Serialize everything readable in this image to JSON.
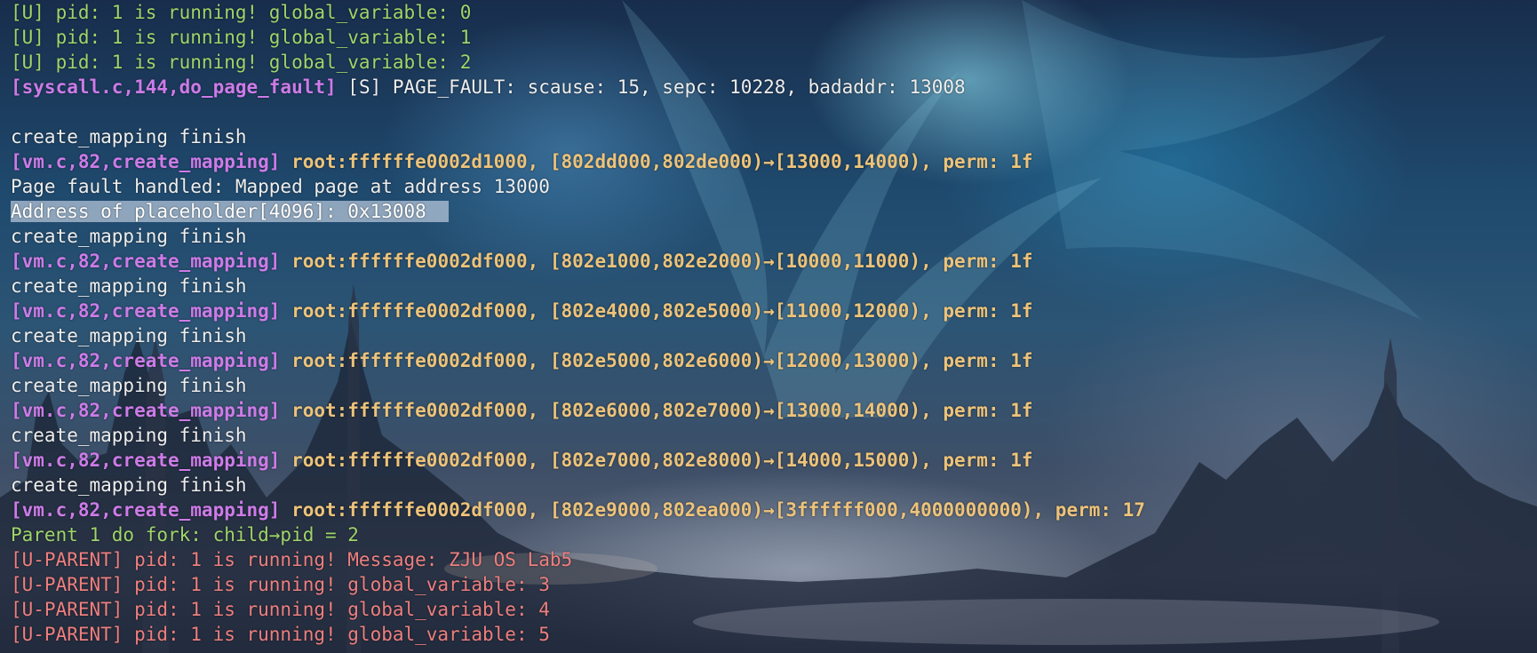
{
  "terminal": {
    "lines": [
      {
        "color": "#9fd56a",
        "segments": [
          {
            "text": "[U] pid: 1 is running! global_variable: 0",
            "style": "green"
          }
        ]
      },
      {
        "color": "#9fd56a",
        "segments": [
          {
            "text": "[U] pid: 1 is running! global_variable: 1",
            "style": "green"
          }
        ]
      },
      {
        "color": "#9fd56a",
        "segments": [
          {
            "text": "[U] pid: 1 is running! global_variable: 2",
            "style": "green"
          }
        ]
      },
      {
        "segments": [
          {
            "text": "[syscall.c,144,do_page_fault]",
            "style": "magenta"
          },
          {
            "text": " [S] PAGE_FAULT: scause: 15, sepc: 10228, badaddr: 13008",
            "style": "white"
          }
        ]
      },
      {
        "segments": [
          {
            "text": "",
            "style": "white"
          }
        ]
      },
      {
        "segments": [
          {
            "text": "create_mapping finish",
            "style": "white"
          }
        ]
      },
      {
        "segments": [
          {
            "text": "[vm.c,82,create_mapping]",
            "style": "magenta"
          },
          {
            "text": " root:ffffffe0002d1000, [802dd000,802de000)→[13000,14000), perm: 1f",
            "style": "orange"
          }
        ]
      },
      {
        "segments": [
          {
            "text": "Page fault handled: Mapped page at address 13000",
            "style": "white"
          }
        ]
      },
      {
        "segments": [
          {
            "text": "Address of placeholder[4096]: 0x13008  ",
            "style": "sel"
          }
        ]
      },
      {
        "segments": [
          {
            "text": "create_mapping finish",
            "style": "white"
          }
        ]
      },
      {
        "segments": [
          {
            "text": "[vm.c,82,create_mapping]",
            "style": "magenta"
          },
          {
            "text": " root:ffffffe0002df000, [802e1000,802e2000)→[10000,11000), perm: 1f",
            "style": "orange"
          }
        ]
      },
      {
        "segments": [
          {
            "text": "create_mapping finish",
            "style": "white"
          }
        ]
      },
      {
        "segments": [
          {
            "text": "[vm.c,82,create_mapping]",
            "style": "magenta"
          },
          {
            "text": " root:ffffffe0002df000, [802e4000,802e5000)→[11000,12000), perm: 1f",
            "style": "orange"
          }
        ]
      },
      {
        "segments": [
          {
            "text": "create_mapping finish",
            "style": "white"
          }
        ]
      },
      {
        "segments": [
          {
            "text": "[vm.c,82,create_mapping]",
            "style": "magenta"
          },
          {
            "text": " root:ffffffe0002df000, [802e5000,802e6000)→[12000,13000), perm: 1f",
            "style": "orange"
          }
        ]
      },
      {
        "segments": [
          {
            "text": "create_mapping finish",
            "style": "white"
          }
        ]
      },
      {
        "segments": [
          {
            "text": "[vm.c,82,create_mapping]",
            "style": "magenta"
          },
          {
            "text": " root:ffffffe0002df000, [802e6000,802e7000)→[13000,14000), perm: 1f",
            "style": "orange"
          }
        ]
      },
      {
        "segments": [
          {
            "text": "create_mapping finish",
            "style": "white"
          }
        ]
      },
      {
        "segments": [
          {
            "text": "[vm.c,82,create_mapping]",
            "style": "magenta"
          },
          {
            "text": " root:ffffffe0002df000, [802e7000,802e8000)→[14000,15000), perm: 1f",
            "style": "orange"
          }
        ]
      },
      {
        "segments": [
          {
            "text": "create_mapping finish",
            "style": "white"
          }
        ]
      },
      {
        "segments": [
          {
            "text": "[vm.c,82,create_mapping]",
            "style": "magenta"
          },
          {
            "text": " root:ffffffe0002df000, [802e9000,802ea000)→[3ffffff000,4000000000), perm: 17",
            "style": "orange"
          }
        ]
      },
      {
        "segments": [
          {
            "text": "Parent 1 do fork: child→pid = 2",
            "style": "green"
          }
        ]
      },
      {
        "segments": [
          {
            "text": "[U-PARENT] pid: 1 is running! Message: ZJU OS Lab5",
            "style": "red"
          }
        ]
      },
      {
        "segments": [
          {
            "text": "[U-PARENT] pid: 1 is running! global_variable: 3",
            "style": "red"
          }
        ]
      },
      {
        "segments": [
          {
            "text": "[U-PARENT] pid: 1 is running! global_variable: 4",
            "style": "red"
          }
        ]
      },
      {
        "segments": [
          {
            "text": "[U-PARENT] pid: 1 is running! global_variable: 5",
            "style": "red"
          }
        ]
      }
    ]
  },
  "colors": {
    "green": "#9fd56a",
    "white": "#eeeeee",
    "magenta": "#cd7be8",
    "orange": "#edc37a",
    "red": "#ee7f7f",
    "selection": "#d7e1f0"
  }
}
